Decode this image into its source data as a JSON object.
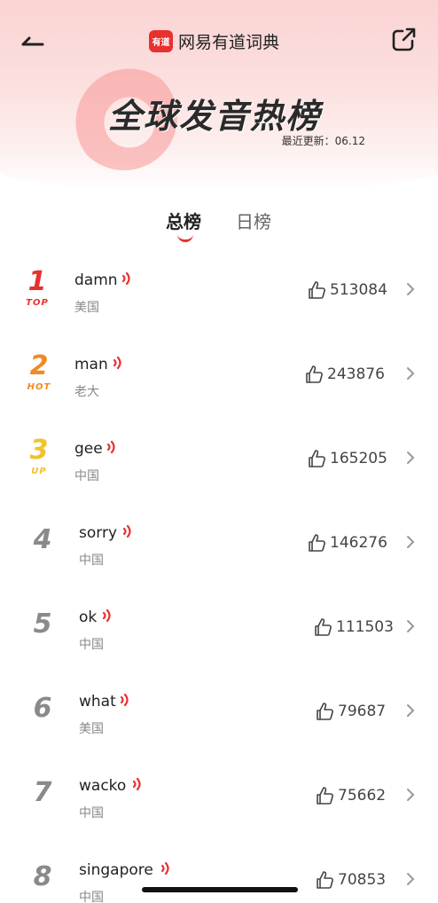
{
  "header": {
    "brand_logo_text": "有道",
    "app_title": "网易有道词典",
    "page_title": "全球发音热榜",
    "update_label": "最近更新：06.12"
  },
  "tabs": [
    {
      "label": "总榜",
      "active": true
    },
    {
      "label": "日榜",
      "active": false
    }
  ],
  "colors": {
    "accent": "#e8312f",
    "rank2": "#f08a24",
    "rank3": "#f4c12a",
    "rank_gray": "#8a8a8a"
  },
  "entries": [
    {
      "rank": "1",
      "tag": "TOP",
      "word": "damn",
      "region": "美国",
      "likes": "513084"
    },
    {
      "rank": "2",
      "tag": "HOT",
      "word": "man",
      "region": "老大",
      "likes": "243876"
    },
    {
      "rank": "3",
      "tag": "UP",
      "word": "gee",
      "region": "中国",
      "likes": "165205"
    },
    {
      "rank": "4",
      "tag": "",
      "word": "sorry",
      "region": "中国",
      "likes": "146276"
    },
    {
      "rank": "5",
      "tag": "",
      "word": "ok",
      "region": "中国",
      "likes": "111503"
    },
    {
      "rank": "6",
      "tag": "",
      "word": "what",
      "region": "美国",
      "likes": "79687"
    },
    {
      "rank": "7",
      "tag": "",
      "word": "wacko",
      "region": "中国",
      "likes": "75662"
    },
    {
      "rank": "8",
      "tag": "",
      "word": "singapore",
      "region": "中国",
      "likes": "70853"
    }
  ]
}
